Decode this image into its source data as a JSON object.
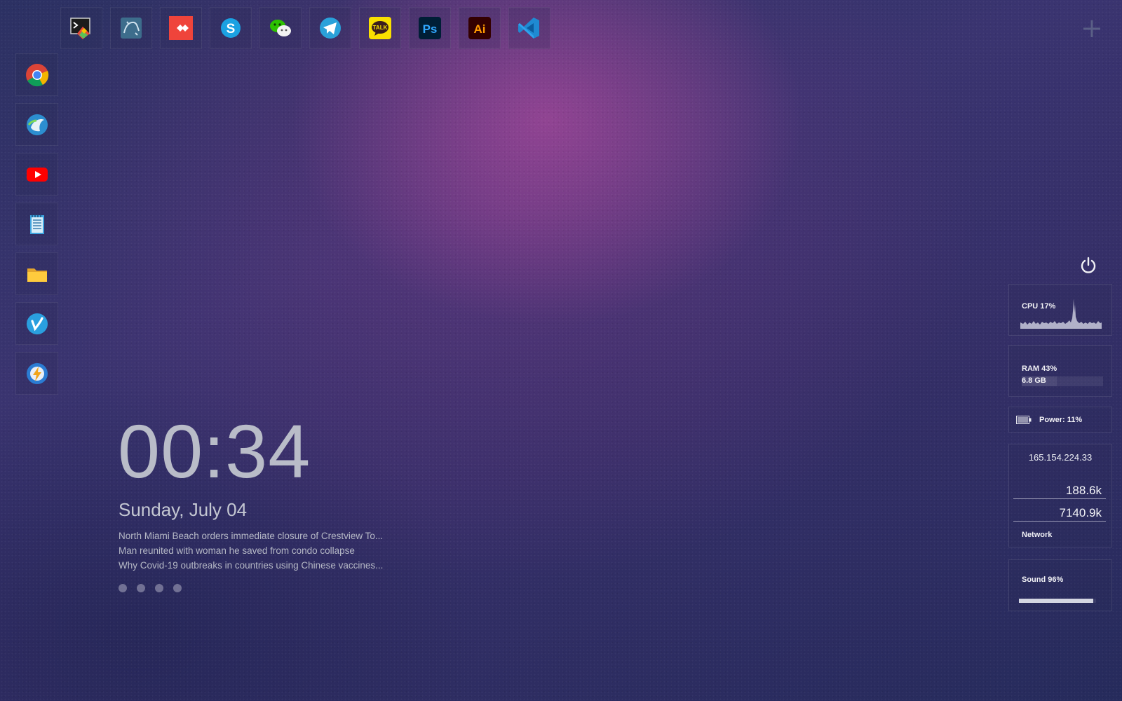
{
  "top_dock": [
    {
      "name": "cmd-tool-icon"
    },
    {
      "name": "mysql-workbench-icon"
    },
    {
      "name": "anydesk-icon"
    },
    {
      "name": "skype-icon"
    },
    {
      "name": "wechat-icon"
    },
    {
      "name": "telegram-icon"
    },
    {
      "name": "kakaotalk-icon",
      "text": "TALK"
    },
    {
      "name": "photoshop-icon",
      "text": "Ps"
    },
    {
      "name": "illustrator-icon",
      "text": "Ai"
    },
    {
      "name": "vscode-icon"
    }
  ],
  "left_dock": [
    {
      "name": "chrome-icon"
    },
    {
      "name": "cyberduck-icon"
    },
    {
      "name": "youtube-icon"
    },
    {
      "name": "notepad-icon"
    },
    {
      "name": "file-explorer-icon"
    },
    {
      "name": "vimeo-icon"
    },
    {
      "name": "flash-app-icon"
    }
  ],
  "clock": {
    "time": "00:34",
    "date": "Sunday, July 04"
  },
  "news": [
    "North Miami Beach orders immediate closure of Crestview To...",
    "Man reunited with woman he saved from condo collapse",
    "Why Covid-19 outbreaks in countries using Chinese vaccines..."
  ],
  "news_pages": 4,
  "system": {
    "cpu_label": "CPU 17%",
    "cpu_percent": 17,
    "ram_label": "RAM 43%",
    "ram_amount": "6.8 GB",
    "ram_percent": 43,
    "power_label": "Power: 11%",
    "battery_percent": 11,
    "ip": "165.154.224.33",
    "upload": "188.6k",
    "download": "7140.9k",
    "network_label": "Network",
    "sound_label": "Sound 96%",
    "sound_percent": 96
  },
  "colors": {
    "accent_text": "#b9bcc8",
    "background_base": "#2c3163",
    "background_glow": "#c850aa"
  }
}
